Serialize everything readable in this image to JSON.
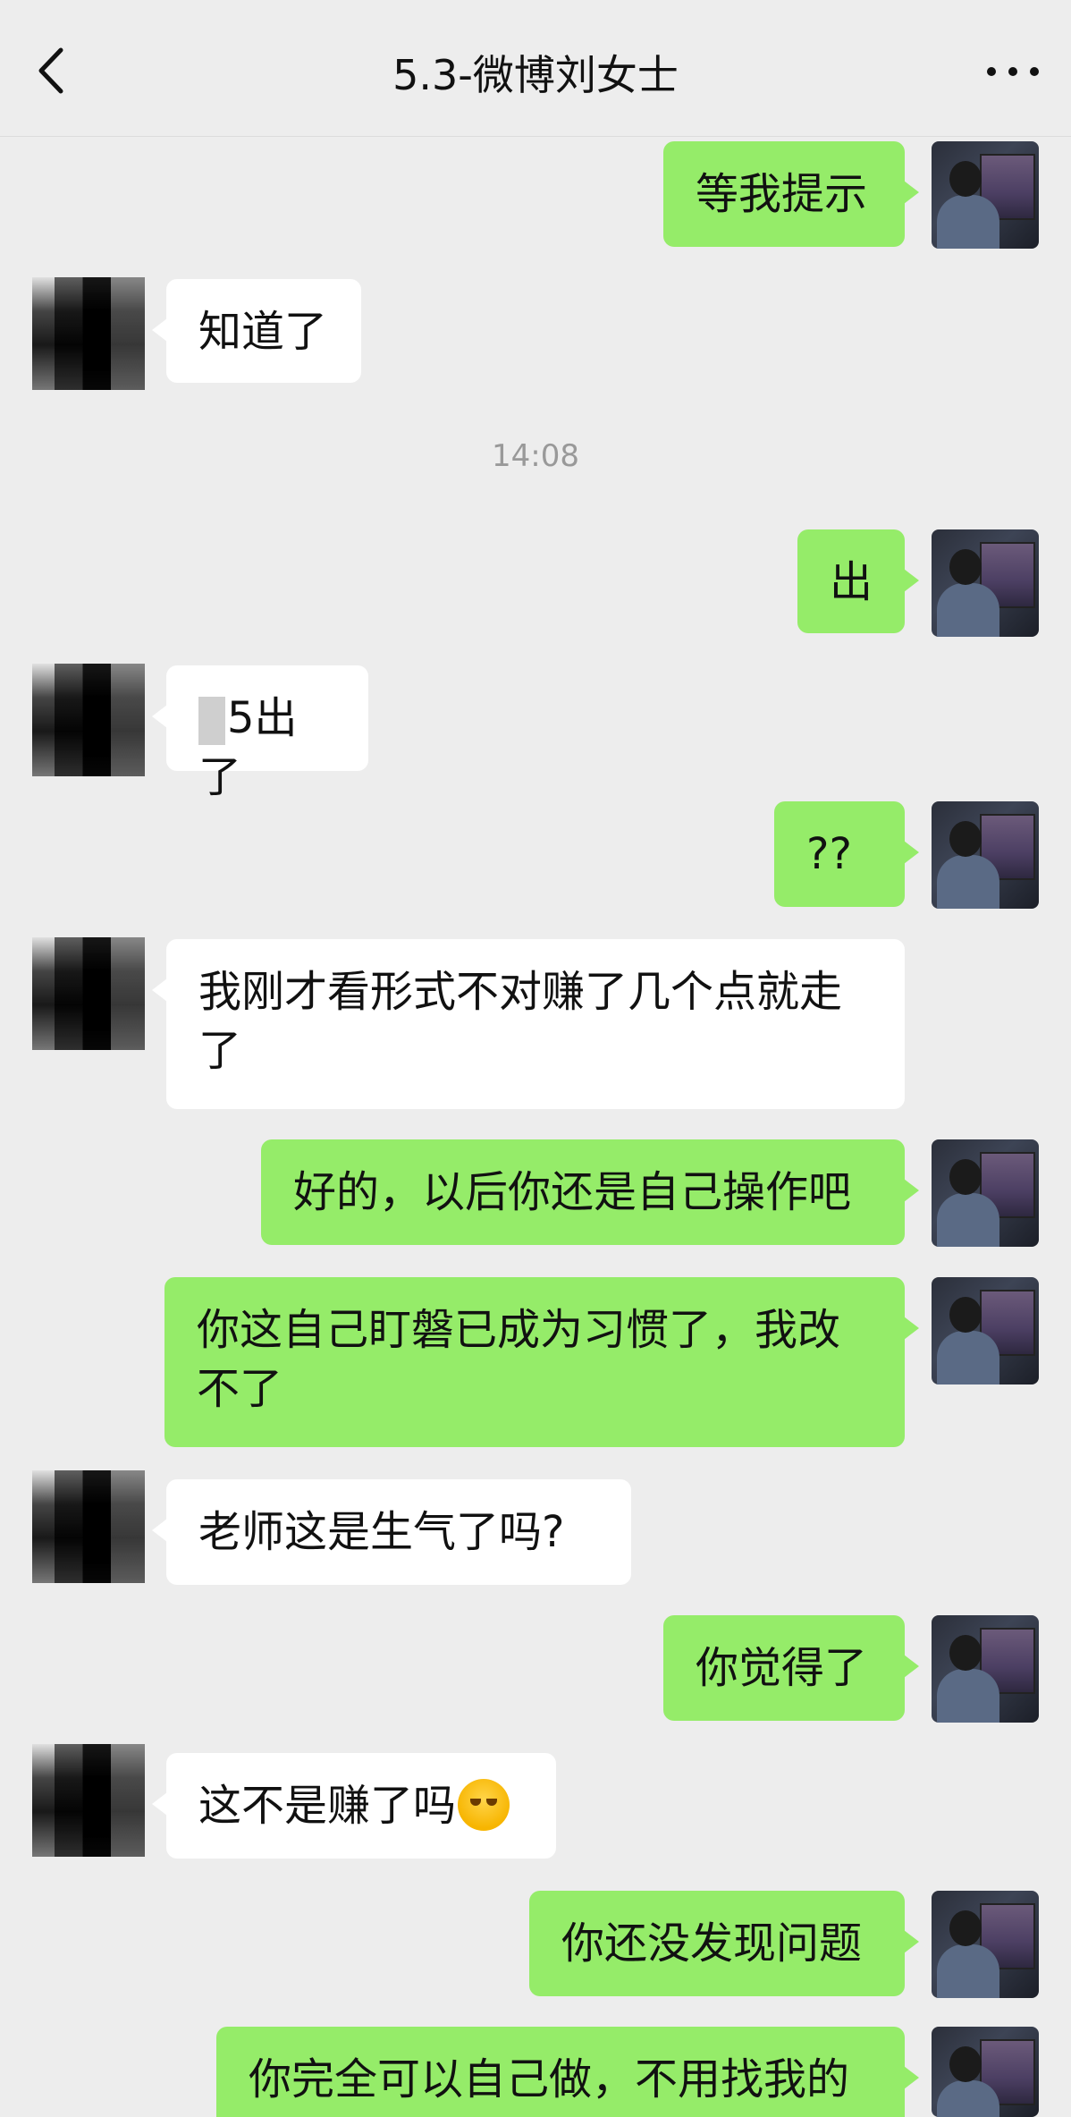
{
  "header": {
    "title": "5.3-微博刘女士"
  },
  "chat": {
    "timestamp": "14:08",
    "messages": [
      {
        "side": "out",
        "text": "等我提示"
      },
      {
        "side": "in",
        "text": "知道了"
      },
      {
        "side": "out",
        "text": "出"
      },
      {
        "side": "in",
        "text": "5出了"
      },
      {
        "side": "out",
        "text": "??"
      },
      {
        "side": "in",
        "text": "我刚才看形式不对赚了几个点就走了"
      },
      {
        "side": "out",
        "text": "好的，以后你还是自己操作吧"
      },
      {
        "side": "out",
        "text": "你这自己盯磐已成为习惯了，我改不了"
      },
      {
        "side": "in",
        "text": "老师这是生气了吗?"
      },
      {
        "side": "out",
        "text": "你觉得了"
      },
      {
        "side": "in",
        "text": "这不是赚了吗",
        "emoji": "crying-laughing-emoji"
      },
      {
        "side": "out",
        "text": "你还没发现问题"
      },
      {
        "side": "out",
        "text": "你完全可以自己做，不用找我的"
      }
    ]
  },
  "icons": {
    "back": "chevron-left-icon",
    "more": "more-dots-icon"
  },
  "colors": {
    "background": "#ededed",
    "outgoing_bubble": "#95ec69",
    "incoming_bubble": "#ffffff",
    "timestamp": "#999999"
  }
}
